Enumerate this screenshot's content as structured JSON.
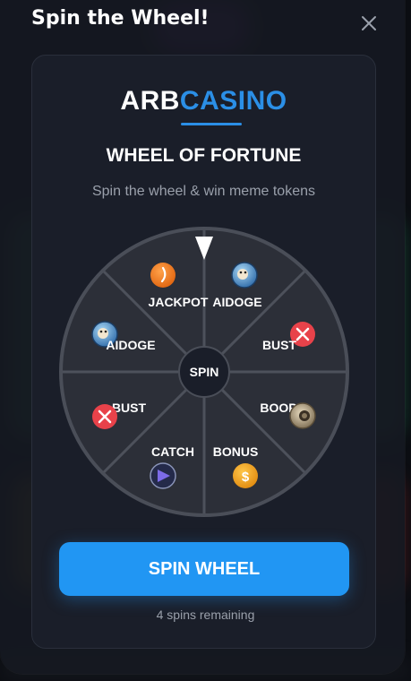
{
  "modal": {
    "title": "Spin the Wheel!",
    "close_icon": "close-icon"
  },
  "brand": {
    "prefix": "ARB",
    "suffix": "CASINO",
    "accent_color": "#2b8fe6"
  },
  "wheel_title": "WHEEL OF FORTUNE",
  "subtitle": "Spin the wheel & win meme tokens",
  "wheel": {
    "center_label": "SPIN",
    "pointer_icon": "triangle-pointer-icon",
    "segments": [
      {
        "label": "AIDOGE",
        "icon": "aidoge-token-icon"
      },
      {
        "label": "BUST",
        "icon": "bust-x-icon"
      },
      {
        "label": "BOOP",
        "icon": "boop-token-icon"
      },
      {
        "label": "BONUS",
        "icon": "dollar-coin-icon"
      },
      {
        "label": "CATCH",
        "icon": "catch-token-icon"
      },
      {
        "label": "BUST",
        "icon": "bust-x-icon"
      },
      {
        "label": "AIDOGE",
        "icon": "aidoge-token-icon"
      },
      {
        "label": "JACKPOT",
        "icon": "jackpot-token-icon"
      }
    ]
  },
  "spin_button": {
    "label": "SPIN WHEEL",
    "color": "#2196f3"
  },
  "spins_remaining": "4 spins remaining"
}
